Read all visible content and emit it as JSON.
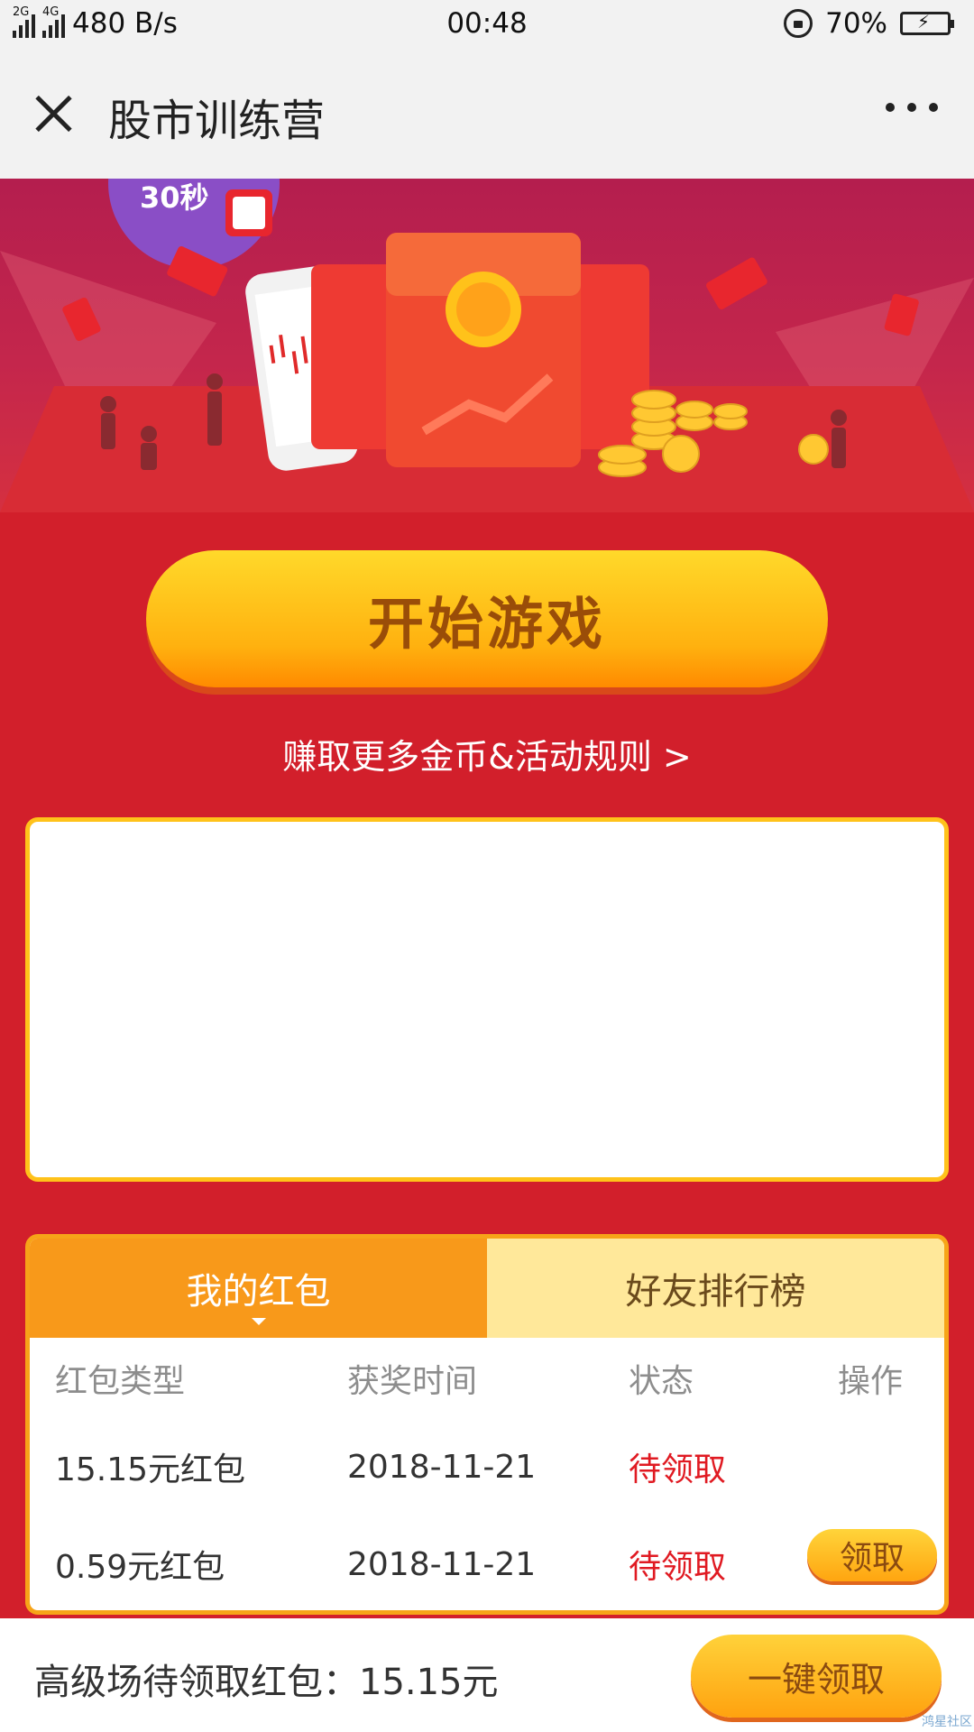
{
  "status_bar": {
    "net_2g": "2G",
    "net_4g": "4G",
    "speed": "480 B/s",
    "time": "00:48",
    "battery": "70%",
    "battery_level": 0.7
  },
  "header": {
    "title": "股市训练营"
  },
  "banner": {
    "timer_text": "30秒"
  },
  "main": {
    "start_button": "开始游戏",
    "rules_link": "赚取更多金币&活动规则 >"
  },
  "packets": {
    "tabs": [
      "我的红包",
      "好友排行榜"
    ],
    "columns": [
      "红包类型",
      "获奖时间",
      "状态",
      "操作"
    ],
    "rows": [
      {
        "type": "15.15元红包",
        "date": "2018-11-21",
        "status": "待领取",
        "action": ""
      },
      {
        "type": "0.59元红包",
        "date": "2018-11-21",
        "status": "待领取",
        "action": "领取"
      }
    ]
  },
  "footer": {
    "pending_text": "高级场待领取红包：15.15元",
    "claim_all": "一键领取",
    "watermark": "鸿星社区"
  },
  "colors": {
    "background": "#d21f2b",
    "accent_gold": "#ffb10f",
    "status_red": "#e01a22",
    "tab_orange": "#f8991a"
  }
}
